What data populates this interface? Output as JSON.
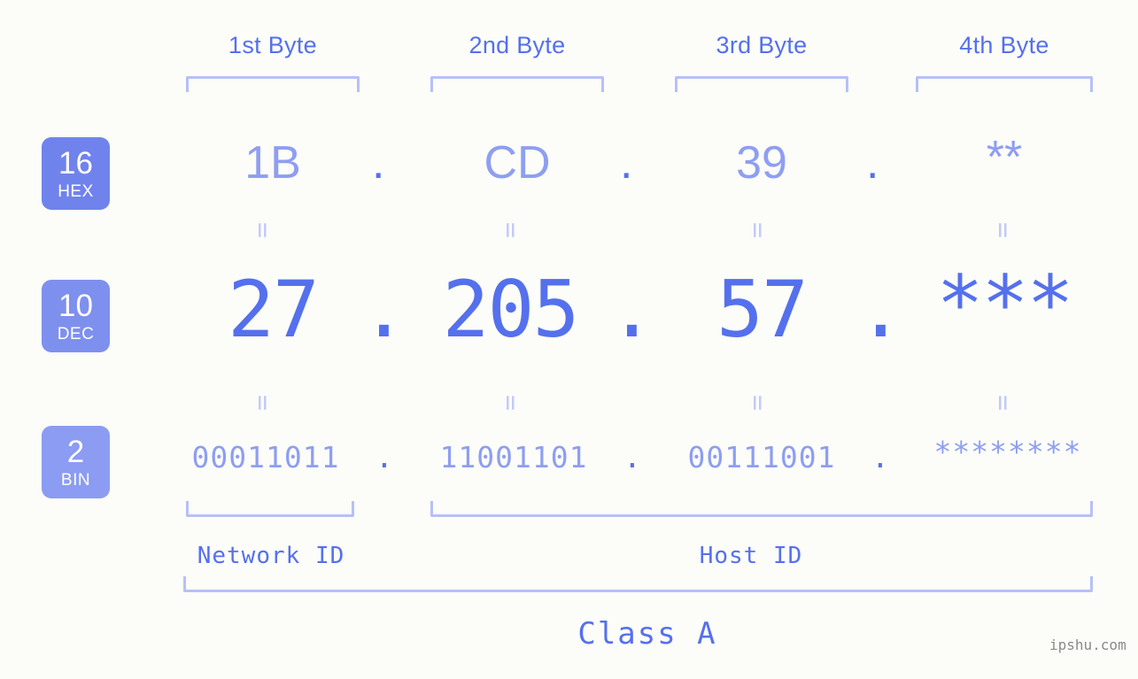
{
  "meta": {
    "background": "#fcfdf8",
    "accent": "#5570ed",
    "accent_light": "#8e9ef2",
    "bracket_color": "#b6c0f7",
    "equals_color": "#c3cbf7",
    "watermark": "ipshu.com"
  },
  "byte_headers": [
    {
      "label": "1st Byte"
    },
    {
      "label": "2nd Byte"
    },
    {
      "label": "3rd Byte"
    },
    {
      "label": "4th Byte"
    }
  ],
  "bases": [
    {
      "number": "16",
      "name": "HEX",
      "color": "#7083ec"
    },
    {
      "number": "10",
      "name": "DEC",
      "color": "#7e90ee"
    },
    {
      "number": "2",
      "name": "BIN",
      "color": "#8b9cf2"
    }
  ],
  "rows": {
    "hex": {
      "values": [
        "1B",
        "CD",
        "39",
        "**"
      ],
      "separator": "."
    },
    "dec": {
      "values": [
        "27",
        "205",
        "57",
        "***"
      ],
      "separator": "."
    },
    "bin": {
      "values": [
        "00011011",
        "11001101",
        "00111001",
        "********"
      ],
      "separator": "."
    }
  },
  "equals_glyph": "=",
  "sections": {
    "network_id": "Network ID",
    "host_id": "Host ID",
    "class": "Class A"
  }
}
